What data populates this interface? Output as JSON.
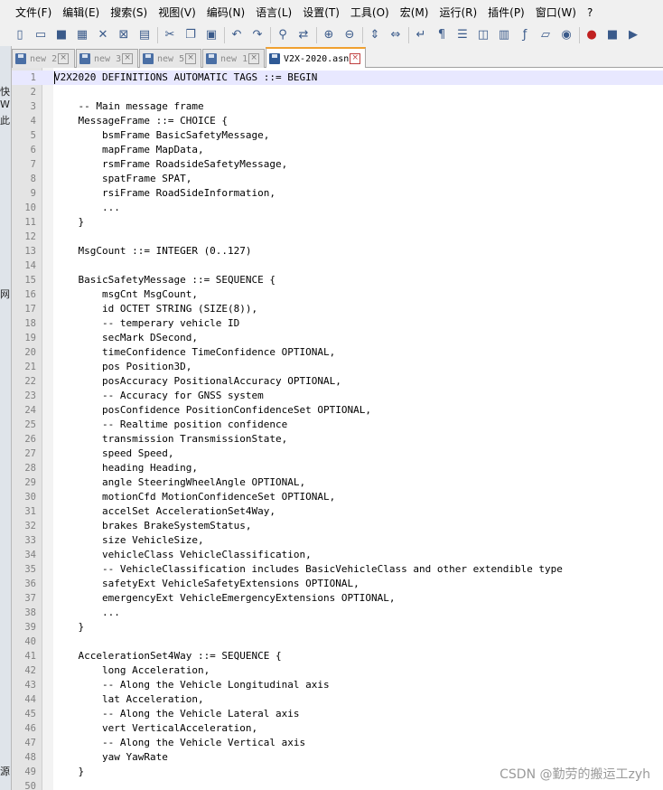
{
  "menu": [
    "文件(F)",
    "编辑(E)",
    "搜索(S)",
    "视图(V)",
    "编码(N)",
    "语言(L)",
    "设置(T)",
    "工具(O)",
    "宏(M)",
    "运行(R)",
    "插件(P)",
    "窗口(W)",
    "?"
  ],
  "toolbar": {
    "icons": [
      "new-file-icon",
      "open-file-icon",
      "save-icon",
      "save-all-icon",
      "close-icon",
      "close-all-icon",
      "print-icon",
      "sep",
      "cut-icon",
      "copy-icon",
      "paste-icon",
      "sep",
      "undo-icon",
      "redo-icon",
      "sep",
      "find-icon",
      "replace-icon",
      "sep",
      "zoom-in-icon",
      "zoom-out-icon",
      "sep",
      "sync-vertical-icon",
      "sync-horizontal-icon",
      "sep",
      "word-wrap-icon",
      "show-all-chars-icon",
      "indent-guide-icon",
      "language-icon",
      "document-map-icon",
      "function-list-icon",
      "folder-workspace-icon",
      "monitoring-icon",
      "sep",
      "record-macro-icon",
      "stop-record-icon",
      "play-macro-icon"
    ]
  },
  "tabs": [
    {
      "label": "new 2",
      "active": false
    },
    {
      "label": "new 3",
      "active": false
    },
    {
      "label": "new 5",
      "active": false
    },
    {
      "label": "new 1",
      "active": false
    },
    {
      "label": "V2X-2020.asn",
      "active": true
    }
  ],
  "left_strip_chars": [
    "快",
    "W",
    "此",
    "",
    "",
    "",
    "",
    "",
    "",
    "",
    "",
    "",
    "",
    "",
    "网",
    "",
    "",
    "",
    "",
    "",
    "",
    "",
    "",
    "",
    "",
    "",
    "",
    "",
    "",
    "",
    "",
    "",
    "",
    "",
    "",
    "",
    "",
    "",
    "",
    "",
    "",
    "",
    "",
    "",
    "",
    "",
    "",
    "源"
  ],
  "editor": {
    "current_line": 1,
    "lines": [
      "V2X2020 DEFINITIONS AUTOMATIC TAGS ::= BEGIN",
      "",
      "    -- Main message frame",
      "    MessageFrame ::= CHOICE {",
      "        bsmFrame BasicSafetyMessage,",
      "        mapFrame MapData,",
      "        rsmFrame RoadsideSafetyMessage,",
      "        spatFrame SPAT,",
      "        rsiFrame RoadSideInformation,",
      "        ...",
      "    }",
      "",
      "    MsgCount ::= INTEGER (0..127)",
      "",
      "    BasicSafetyMessage ::= SEQUENCE {",
      "        msgCnt MsgCount,",
      "        id OCTET STRING (SIZE(8)),",
      "        -- temperary vehicle ID",
      "        secMark DSecond,",
      "        timeConfidence TimeConfidence OPTIONAL,",
      "        pos Position3D,",
      "        posAccuracy PositionalAccuracy OPTIONAL,",
      "        -- Accuracy for GNSS system",
      "        posConfidence PositionConfidenceSet OPTIONAL,",
      "        -- Realtime position confidence",
      "        transmission TransmissionState,",
      "        speed Speed,",
      "        heading Heading,",
      "        angle SteeringWheelAngle OPTIONAL,",
      "        motionCfd MotionConfidenceSet OPTIONAL,",
      "        accelSet AccelerationSet4Way,",
      "        brakes BrakeSystemStatus,",
      "        size VehicleSize,",
      "        vehicleClass VehicleClassification,",
      "        -- VehicleClassification includes BasicVehicleClass and other extendible type",
      "        safetyExt VehicleSafetyExtensions OPTIONAL,",
      "        emergencyExt VehicleEmergencyExtensions OPTIONAL,",
      "        ...",
      "    }",
      "",
      "    AccelerationSet4Way ::= SEQUENCE {",
      "        long Acceleration,",
      "        -- Along the Vehicle Longitudinal axis",
      "        lat Acceleration,",
      "        -- Along the Vehicle Lateral axis",
      "        vert VerticalAcceleration,",
      "        -- Along the Vehicle Vertical axis",
      "        yaw YawRate",
      "    }",
      ""
    ]
  },
  "watermark": "CSDN @勤劳的搬运工zyh"
}
